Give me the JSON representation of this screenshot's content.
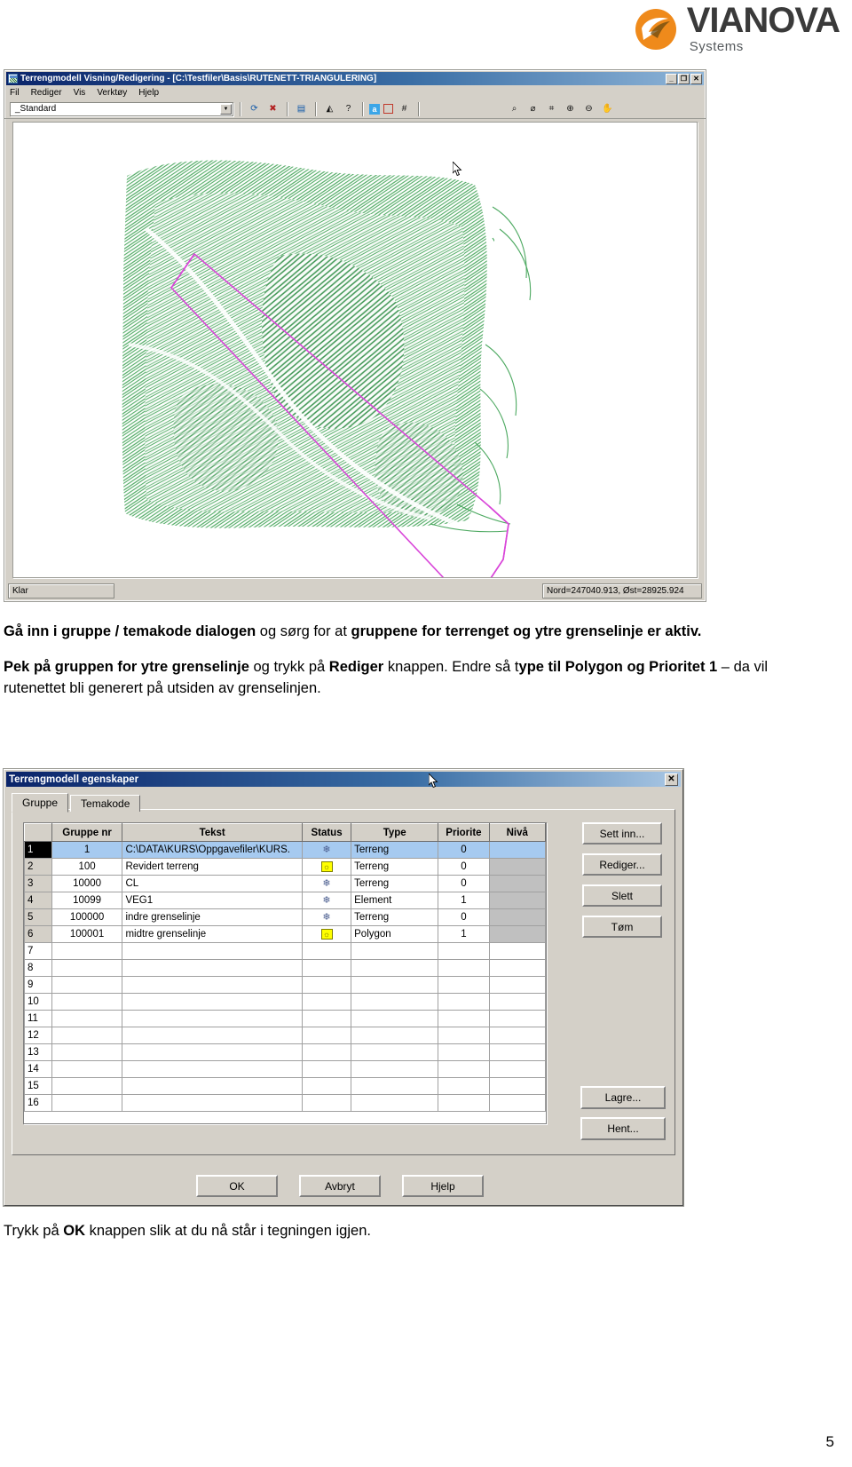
{
  "brand": {
    "name": "VIANOVA",
    "subtitle": "Systems",
    "accent_color": "#ef8a1b",
    "logo_icon": "vianova-disc-logo"
  },
  "app_window": {
    "title": "Terrengmodell Visning/Redigering - [C:\\Testfiler\\Basis\\RUTENETT-TRIANGULERING]",
    "title_icon": "terrain-model-icon",
    "window_buttons": [
      "minimize",
      "restore",
      "close"
    ],
    "window_button_glyphs": {
      "minimize": "_",
      "restore": "❐",
      "close": "✕"
    },
    "menu": [
      "Fil",
      "Rediger",
      "Vis",
      "Verktøy",
      "Hjelp"
    ],
    "toolbar": {
      "style_combo_value": "_Standard",
      "icons": [
        "refresh-icon",
        "delete-model-icon",
        "properties-icon",
        "triangulate-icon",
        "help-question-icon",
        "annotation-a-icon",
        "grid-frame-icon",
        "hatch-icon",
        "zoom-all-icon",
        "zoom-previous-icon",
        "zoom-window-icon",
        "zoom-in-icon",
        "zoom-out-icon",
        "pan-icon"
      ]
    },
    "status": {
      "left": "Klar",
      "right": "Nord=247040.913, Øst=28925.924"
    },
    "map": {
      "terrain_color": "#3aa050",
      "boundary_color": "#d946d9",
      "background": "#ffffff"
    }
  },
  "instructions": {
    "p1_bold_a": "Gå inn i gruppe / temakode dialogen",
    "p1_mid": " og sørg for at ",
    "p1_bold_b": "gruppene for terrenget og ytre grenselinje er aktiv.",
    "p2_bold_a": "Pek på gruppen for ytre grenselinje",
    "p2_mid_a": " og trykk på ",
    "p2_bold_b": "Rediger",
    "p2_mid_b": " knappen. Endre så t",
    "p2_bold_c": "ype til Polygon og Prioritet 1",
    "p2_tail": " – da vil rutenettet bli generert på utsiden av grenselinjen."
  },
  "dialog": {
    "title": "Terrengmodell egenskaper",
    "close_glyph": "✕",
    "tabs": [
      {
        "label": "Gruppe",
        "active": true
      },
      {
        "label": "Temakode",
        "active": false
      }
    ],
    "grid": {
      "headers": [
        "",
        "Gruppe nr",
        "Tekst",
        "Status",
        "Type",
        "Priorite",
        "Nivå"
      ],
      "rows": [
        {
          "idx": "1",
          "nr": "1",
          "tekst": "C:\\DATA\\KURS\\Oppgavefiler\\KURS.",
          "status": "snow",
          "type": "Terreng",
          "prio": "0",
          "niva": "",
          "selected": true
        },
        {
          "idx": "2",
          "nr": "100",
          "tekst": "Revidert terreng",
          "status": "sun",
          "type": "Terreng",
          "prio": "0",
          "niva": "",
          "selected": false
        },
        {
          "idx": "3",
          "nr": "10000",
          "tekst": "CL",
          "status": "snow",
          "type": "Terreng",
          "prio": "0",
          "niva": "",
          "selected": false
        },
        {
          "idx": "4",
          "nr": "10099",
          "tekst": "VEG1",
          "status": "snow",
          "type": "Element",
          "prio": "1",
          "niva": "",
          "selected": false
        },
        {
          "idx": "5",
          "nr": "100000",
          "tekst": "indre grenselinje",
          "status": "snow",
          "type": "Terreng",
          "prio": "0",
          "niva": "",
          "selected": false
        },
        {
          "idx": "6",
          "nr": "100001",
          "tekst": "midtre grenselinje",
          "status": "sun",
          "type": "Polygon",
          "prio": "1",
          "niva": "",
          "selected": false
        },
        {
          "idx": "7",
          "nr": "",
          "tekst": "",
          "status": "",
          "type": "",
          "prio": "",
          "niva": "",
          "selected": false
        },
        {
          "idx": "8",
          "nr": "",
          "tekst": "",
          "status": "",
          "type": "",
          "prio": "",
          "niva": "",
          "selected": false
        },
        {
          "idx": "9",
          "nr": "",
          "tekst": "",
          "status": "",
          "type": "",
          "prio": "",
          "niva": "",
          "selected": false
        },
        {
          "idx": "10",
          "nr": "",
          "tekst": "",
          "status": "",
          "type": "",
          "prio": "",
          "niva": "",
          "selected": false
        },
        {
          "idx": "11",
          "nr": "",
          "tekst": "",
          "status": "",
          "type": "",
          "prio": "",
          "niva": "",
          "selected": false
        },
        {
          "idx": "12",
          "nr": "",
          "tekst": "",
          "status": "",
          "type": "",
          "prio": "",
          "niva": "",
          "selected": false
        },
        {
          "idx": "13",
          "nr": "",
          "tekst": "",
          "status": "",
          "type": "",
          "prio": "",
          "niva": "",
          "selected": false
        },
        {
          "idx": "14",
          "nr": "",
          "tekst": "",
          "status": "",
          "type": "",
          "prio": "",
          "niva": "",
          "selected": false
        },
        {
          "idx": "15",
          "nr": "",
          "tekst": "",
          "status": "",
          "type": "",
          "prio": "",
          "niva": "",
          "selected": false
        },
        {
          "idx": "16",
          "nr": "",
          "tekst": "",
          "status": "",
          "type": "",
          "prio": "",
          "niva": "",
          "selected": false
        }
      ]
    },
    "side_buttons": [
      "Sett inn...",
      "Rediger...",
      "Slett",
      "Tøm"
    ],
    "side_buttons2": [
      "Lagre...",
      "Hent..."
    ],
    "footer_buttons": [
      "OK",
      "Avbryt",
      "Hjelp"
    ]
  },
  "footer": {
    "text_a": "Trykk på ",
    "text_bold": "OK",
    "text_b": " knappen slik at du nå står i tegningen igjen.",
    "page_number": "5"
  }
}
